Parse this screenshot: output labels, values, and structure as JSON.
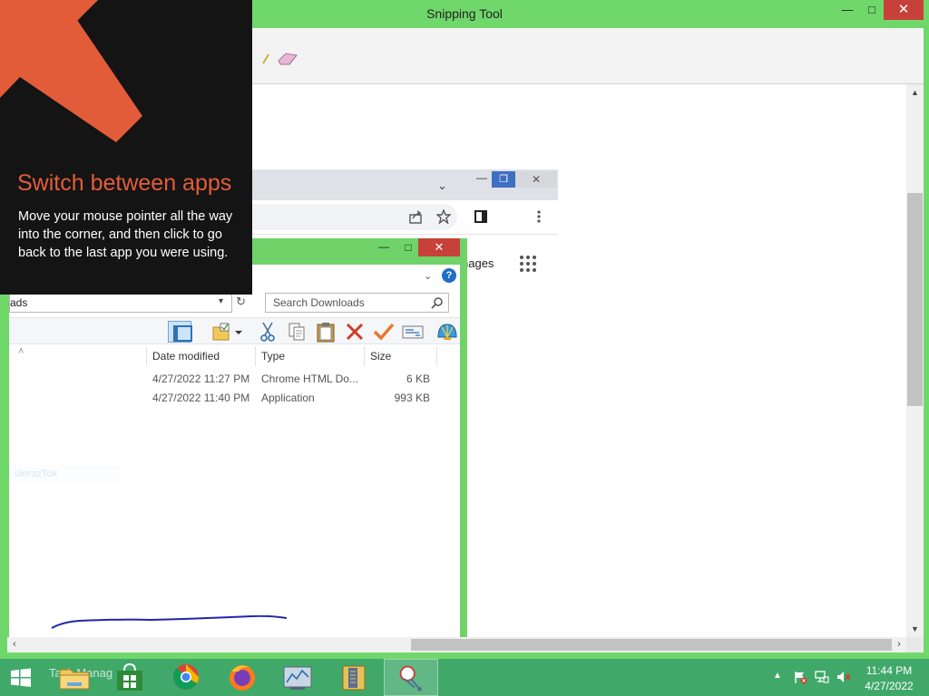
{
  "snipping_tool": {
    "title": "Snipping Tool",
    "minimize": "—",
    "maximize": "□",
    "close": "✕"
  },
  "tip": {
    "title": "Switch between apps",
    "body": "Move your mouse pointer all the way into the corner, and then click to go back to the last app you were using."
  },
  "browser": {
    "images_link": "nages",
    "tabs_dropdown": "⌄",
    "minimize": "—",
    "restore": "❐",
    "close": "✕"
  },
  "explorer": {
    "minimize": "—",
    "maximize": "□",
    "close": "✕",
    "address": "ads",
    "search_placeholder": "Search Downloads",
    "columns": {
      "date_modified": "Date modified",
      "type": "Type",
      "size": "Size"
    },
    "files": [
      {
        "date_modified": "4/27/2022 11:27 PM",
        "type": "Chrome HTML Do...",
        "size": "6 KB"
      },
      {
        "date_modified": "4/27/2022 11:40 PM",
        "type": "Application",
        "size": "993 KB"
      }
    ],
    "faded_label": "ulerazTok"
  },
  "taskbar": {
    "search_text": "Task Manag",
    "clock_time": "11:44 PM",
    "clock_date": "4/27/2022",
    "colors": {
      "taskbar": "#40a96a",
      "window_frame": "#70d86b",
      "accent": "#e35c3a"
    }
  }
}
